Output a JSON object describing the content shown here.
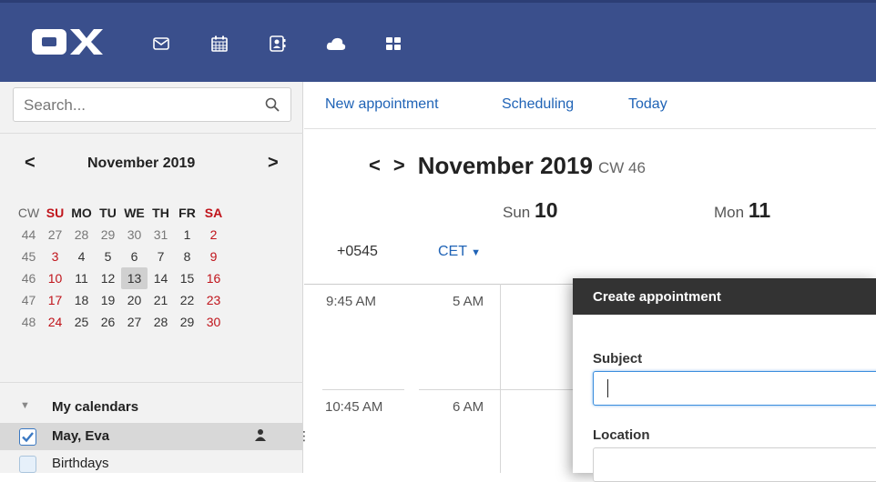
{
  "topbar": {
    "logo_text": "OX",
    "apps": [
      "mail-icon",
      "calendar-icon",
      "contacts-icon",
      "cloud-icon",
      "apps-grid-icon"
    ]
  },
  "search": {
    "placeholder": "Search..."
  },
  "mini_calendar": {
    "title": "November 2019",
    "prev": "<",
    "next": ">",
    "headers": [
      "CW",
      "SU",
      "MO",
      "TU",
      "WE",
      "TH",
      "FR",
      "SA"
    ],
    "weeks": [
      {
        "cw": "44",
        "days": [
          "27",
          "28",
          "29",
          "30",
          "31",
          "1",
          "2"
        ]
      },
      {
        "cw": "45",
        "days": [
          "3",
          "4",
          "5",
          "6",
          "7",
          "8",
          "9"
        ]
      },
      {
        "cw": "46",
        "days": [
          "10",
          "11",
          "12",
          "13",
          "14",
          "15",
          "16"
        ]
      },
      {
        "cw": "47",
        "days": [
          "17",
          "18",
          "19",
          "20",
          "21",
          "22",
          "23"
        ]
      },
      {
        "cw": "48",
        "days": [
          "24",
          "25",
          "26",
          "27",
          "28",
          "29",
          "30"
        ]
      }
    ],
    "selected_day": "13"
  },
  "my_calendars": {
    "label": "My calendars",
    "items": [
      {
        "name": "May, Eva",
        "checked": true
      },
      {
        "name": "Birthdays",
        "checked": false
      }
    ]
  },
  "toolbar": {
    "new_appointment": "New appointment",
    "scheduling": "Scheduling",
    "today": "Today"
  },
  "view": {
    "prev": "<",
    "next": ">",
    "title": "November 2019",
    "cw": "CW 46",
    "days": [
      {
        "dow": "Sun",
        "num": "10"
      },
      {
        "dow": "Mon",
        "num": "11"
      }
    ],
    "tz_offset": "+0545",
    "tz_select": "CET",
    "times": [
      {
        "primary": "9:45 AM",
        "secondary": "5 AM"
      },
      {
        "primary": "10:45 AM",
        "secondary": "6 AM"
      }
    ]
  },
  "dialog": {
    "title": "Create appointment",
    "subject_label": "Subject",
    "subject_value": "",
    "location_label": "Location",
    "location_value": ""
  },
  "colors": {
    "topbar": "#3a4f8c",
    "link": "#1f63b6",
    "weekend": "#c0141b",
    "dialog_header": "#333333"
  }
}
